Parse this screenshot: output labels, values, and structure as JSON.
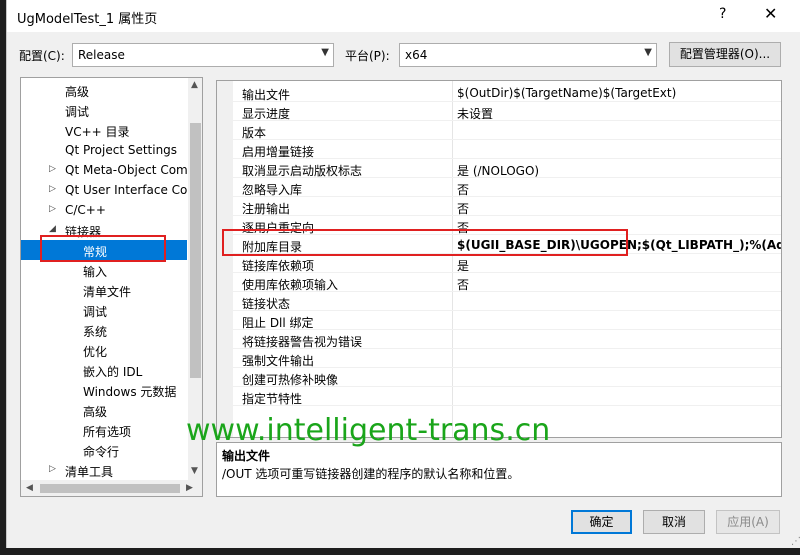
{
  "window": {
    "title": "UgModelTest_1 属性页",
    "help": "?",
    "close": "✕"
  },
  "config": {
    "label": "配置(C):",
    "value": "Release"
  },
  "platform": {
    "label": "平台(P):",
    "value": "x64"
  },
  "config_manager_label": "配置管理器(O)...",
  "tree": [
    {
      "label": "高级",
      "indent": 0,
      "expander": ""
    },
    {
      "label": "调试",
      "indent": 0,
      "expander": ""
    },
    {
      "label": "VC++ 目录",
      "indent": 0,
      "expander": ""
    },
    {
      "label": "Qt Project Settings",
      "indent": 0,
      "expander": ""
    },
    {
      "label": "Qt Meta-Object Com",
      "indent": 0,
      "expander": "▷"
    },
    {
      "label": "Qt User Interface Cor",
      "indent": 0,
      "expander": "▷"
    },
    {
      "label": "C/C++",
      "indent": 0,
      "expander": "▷"
    },
    {
      "label": "链接器",
      "indent": 0,
      "expander": "◢"
    },
    {
      "label": "常规",
      "indent": 1,
      "expander": "",
      "selected": true
    },
    {
      "label": "输入",
      "indent": 1,
      "expander": ""
    },
    {
      "label": "清单文件",
      "indent": 1,
      "expander": ""
    },
    {
      "label": "调试",
      "indent": 1,
      "expander": ""
    },
    {
      "label": "系统",
      "indent": 1,
      "expander": ""
    },
    {
      "label": "优化",
      "indent": 1,
      "expander": ""
    },
    {
      "label": "嵌入的 IDL",
      "indent": 1,
      "expander": ""
    },
    {
      "label": "Windows 元数据",
      "indent": 1,
      "expander": ""
    },
    {
      "label": "高级",
      "indent": 1,
      "expander": ""
    },
    {
      "label": "所有选项",
      "indent": 1,
      "expander": ""
    },
    {
      "label": "命令行",
      "indent": 1,
      "expander": ""
    },
    {
      "label": "清单工具",
      "indent": 0,
      "expander": "▷"
    }
  ],
  "properties": [
    {
      "name": "输出文件",
      "value": "$(OutDir)$(TargetName)$(TargetExt)"
    },
    {
      "name": "显示进度",
      "value": "未设置"
    },
    {
      "name": "版本",
      "value": ""
    },
    {
      "name": "启用增量链接",
      "value": ""
    },
    {
      "name": "取消显示启动版权标志",
      "value": "是 (/NOLOGO)"
    },
    {
      "name": "忽略导入库",
      "value": "否"
    },
    {
      "name": "注册输出",
      "value": "否"
    },
    {
      "name": "逐用户重定向",
      "value": "否"
    },
    {
      "name": "附加库目录",
      "value": "$(UGII_BASE_DIR)\\UGOPEN;$(Qt_LIBPATH_);%(AdditionalLibraryDirectories)",
      "bold": true
    },
    {
      "name": "链接库依赖项",
      "value": "是"
    },
    {
      "name": "使用库依赖项输入",
      "value": "否"
    },
    {
      "name": "链接状态",
      "value": ""
    },
    {
      "name": "阻止 Dll 绑定",
      "value": ""
    },
    {
      "name": "将链接器警告视为错误",
      "value": ""
    },
    {
      "name": "强制文件输出",
      "value": ""
    },
    {
      "name": "创建可热修补映像",
      "value": ""
    },
    {
      "name": "指定节特性",
      "value": ""
    }
  ],
  "description": {
    "title": "输出文件",
    "text": "/OUT 选项可重写链接器创建的程序的默认名称和位置。"
  },
  "buttons": {
    "ok": "确定",
    "cancel": "取消",
    "apply": "应用(A)"
  },
  "watermark": "www.intelligent-trans.cn",
  "highlight_color": "#e02020",
  "selection_color": "#0078d7"
}
